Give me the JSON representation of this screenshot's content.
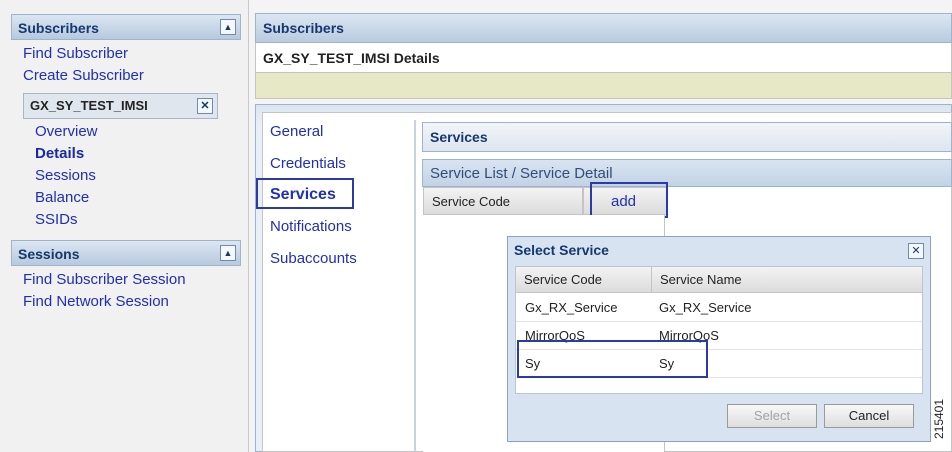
{
  "sidebar": {
    "subscribers_title": "Subscribers",
    "find_subscriber": "Find Subscriber",
    "create_subscriber": "Create Subscriber",
    "current_subscriber": "GX_SY_TEST_IMSI",
    "sub_items": [
      "Overview",
      "Details",
      "Sessions",
      "Balance",
      "SSIDs"
    ],
    "sessions_title": "Sessions",
    "find_subscriber_session": "Find Subscriber Session",
    "find_network_session": "Find Network Session"
  },
  "main": {
    "header_title": "Subscribers",
    "details_title": "GX_SY_TEST_IMSI Details",
    "tabs": [
      "General",
      "Credentials",
      "Services",
      "Notifications",
      "Subaccounts"
    ],
    "services_title": "Services",
    "service_list_title": "Service List / Service Detail",
    "service_code_col": "Service Code",
    "add_label": "add"
  },
  "dialog": {
    "title": "Select Service",
    "columns": [
      "Service Code",
      "Service Name"
    ],
    "rows": [
      {
        "code": "Gx_RX_Service",
        "name": "Gx_RX_Service"
      },
      {
        "code": "MirrorQoS",
        "name": "MirrorQoS"
      },
      {
        "code": "Sy",
        "name": "Sy"
      }
    ],
    "select_label": "Select",
    "cancel_label": "Cancel"
  },
  "figure_id": "215401",
  "icons": {
    "collapse": "collapse-up-icon",
    "close": "close-icon"
  }
}
